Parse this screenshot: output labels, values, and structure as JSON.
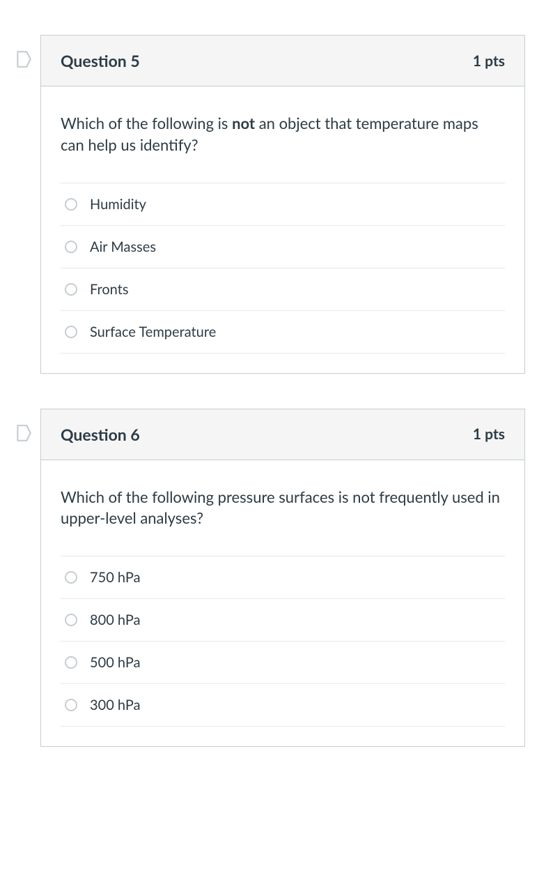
{
  "questions": [
    {
      "title": "Question 5",
      "points": "1 pts",
      "prompt_pre": "Which of the following is ",
      "prompt_bold": "not",
      "prompt_post": " an object that temperature maps can help us identify?",
      "options": [
        "Humidity",
        "Air Masses",
        "Fronts",
        "Surface Temperature"
      ]
    },
    {
      "title": "Question 6",
      "points": "1 pts",
      "prompt_pre": "Which of the following pressure surfaces is not frequently used in upper-level analyses?",
      "prompt_bold": "",
      "prompt_post": "",
      "options": [
        "750 hPa",
        "800 hPa",
        "500 hPa",
        "300 hPa"
      ]
    }
  ]
}
